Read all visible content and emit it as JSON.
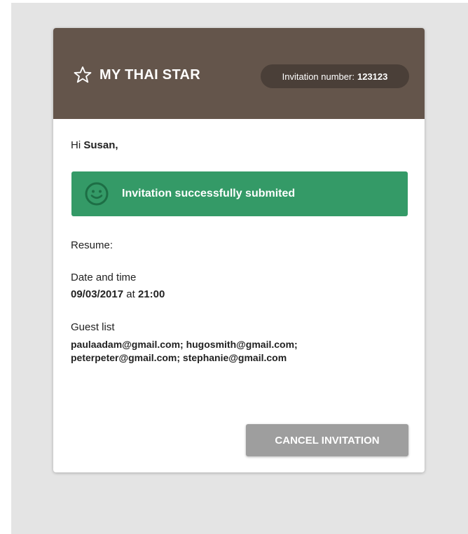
{
  "header": {
    "brand_name": "MY THAI STAR",
    "brand_icon": "star-icon",
    "invitation_label": "Invitation number:",
    "invitation_number": "123123"
  },
  "greeting": {
    "prefix": "Hi",
    "name": "Susan,"
  },
  "alert": {
    "icon": "smiley-icon",
    "message": "Invitation successfully submited"
  },
  "summary": {
    "resume_label": "Resume:",
    "date_time_label": "Date and time",
    "date": "09/03/2017",
    "at_word": "at",
    "time": "21:00",
    "guest_list_label": "Guest list",
    "guest_line_1": "paulaadam@gmail.com; hugosmith@gmail.com;",
    "guest_line_2": "peterpeter@gmail.com; stephanie@gmail.com"
  },
  "actions": {
    "cancel_label": "CANCEL INVITATION"
  },
  "colors": {
    "header_bg": "#64554b",
    "pill_bg": "#4a3f38",
    "success": "#349a67",
    "button_disabled": "#9e9e9e",
    "page_bg": "#e4e4e4"
  }
}
